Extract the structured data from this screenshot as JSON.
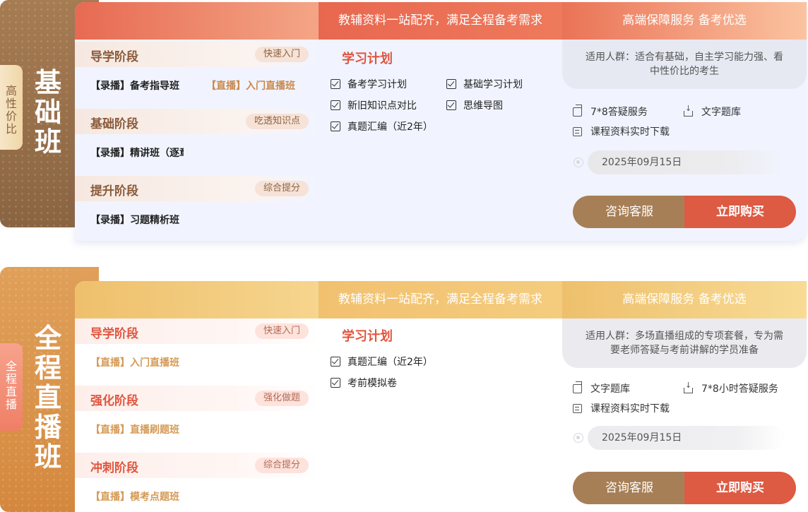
{
  "cards": [
    {
      "side_title": "基础班",
      "tag": "高性价比",
      "header_mid": "教辅资料一站配齐，满足全程备考需求",
      "header_right": "高端保障服务 备考优选",
      "stages": [
        {
          "title": "导学阶段",
          "badge": "快速入门",
          "courses": [
            "【录播】备考指导班",
            "【直播】入门直播班"
          ]
        },
        {
          "title": "基础阶段",
          "badge": "吃透知识点",
          "courses": [
            "【录播】精讲班（逐章"
          ]
        },
        {
          "title": "提升阶段",
          "badge": "综合提分",
          "courses": [
            "【录播】习题精析班"
          ]
        }
      ],
      "plan_title": "学习计划",
      "plan_items": [
        "备考学习计划",
        "基础学习计划",
        "新旧知识点对比",
        "思维导图",
        "真题汇编（近2年）"
      ],
      "audience": "适用人群：适合有基础，自主学习能力强、看中性价比的考生",
      "features": [
        "7*8答疑服务",
        "文字题库",
        "课程资料实时下载"
      ],
      "date": "2025年09月15日",
      "consult_label": "咨询客服",
      "buy_label": "立即购买"
    },
    {
      "side_title": "全程直播班",
      "tag": "全程直播",
      "header_mid": "教辅资料一站配齐，满足全程备考需求",
      "header_right": "高端保障服务 备考优选",
      "stages": [
        {
          "title": "导学阶段",
          "badge": "快速入门",
          "courses": [
            "【直播】入门直播班"
          ]
        },
        {
          "title": "强化阶段",
          "badge": "强化做题",
          "courses": [
            "【直播】直播刷题班"
          ]
        },
        {
          "title": "冲刺阶段",
          "badge": "综合提分",
          "courses": [
            "【直播】模考点题班"
          ]
        }
      ],
      "plan_title": "学习计划",
      "plan_items": [
        "真题汇编（近2年）",
        "考前模拟卷"
      ],
      "audience": "适用人群：多场直播组成的专项套餐，专为需要老师答疑与考前讲解的学员准备",
      "features": [
        "文字题库",
        "7*8小时答疑服务",
        "课程资料实时下载"
      ],
      "date": "2025年09月15日",
      "consult_label": "咨询客服",
      "buy_label": "立即购买"
    }
  ]
}
